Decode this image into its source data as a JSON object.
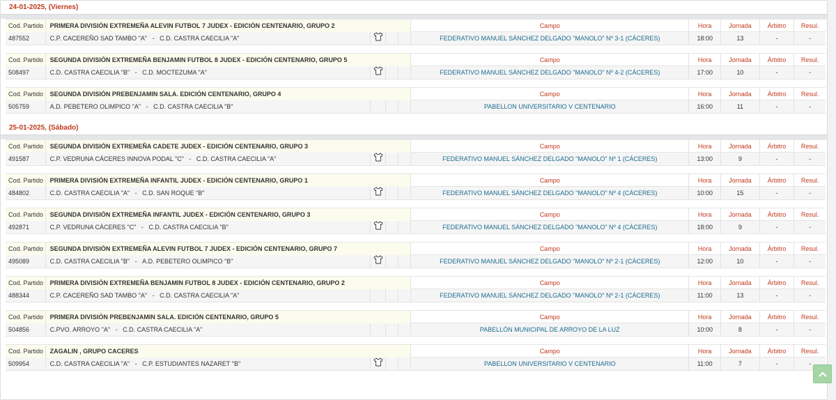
{
  "labels": {
    "code": "Cod. Partido",
    "campo": "Campo",
    "hora": "Hora",
    "jornada": "Jornada",
    "arbitro": "Árbitro",
    "resul": "Resul."
  },
  "days": [
    {
      "date": "24-01-2025,  (Viernes)",
      "matches": [
        {
          "competition": "PRIMERA DIVISIÓN EXTREMEÑA ALEVIN FUTBOL 7 JUDEX - EDICIÓN CENTENARIO, GRUPO 2",
          "code": "487552",
          "home": "C.P. CACEREÑO SAD TAMBO \"A\"",
          "away": "C.D. CASTRA CAECILIA \"A\"",
          "shirt": true,
          "campo": "FEDERATIVO MANUEL SÁNCHEZ DELGADO \"MANOLO\" Nº 3-1 (CÁCERES)",
          "hora": "18:00",
          "jornada": "13",
          "arbitro": "-",
          "resul": "-"
        },
        {
          "competition": "SEGUNDA DIVISIÓN EXTREMEÑA BENJAMIN FUTBOL 8 JUDEX - EDICIÓN CENTENARIO, GRUPO 5",
          "code": "508497",
          "home": "C.D. CASTRA CAECILIA \"B\"",
          "away": "C.D. MOCTEZUMA \"A\"",
          "shirt": true,
          "campo": "FEDERATIVO MANUEL SÁNCHEZ DELGADO \"MANOLO\" Nº 4-2 (CÁCERES)",
          "hora": "17:00",
          "jornada": "10",
          "arbitro": "-",
          "resul": "-"
        },
        {
          "competition": "SEGUNDA DIVISIÓN PREBENJAMIN SALA. EDICIÓN CENTENARIO, GRUPO 4",
          "code": "505759",
          "home": "A.D. PEBETERO OLIMPICO \"A\"",
          "away": "C.D. CASTRA CAECILIA \"B\"",
          "shirt": false,
          "campo": "PABELLON UNIVERSITARIO V CENTENARIO",
          "hora": "16:00",
          "jornada": "11",
          "arbitro": "-",
          "resul": "-"
        }
      ]
    },
    {
      "date": "25-01-2025,  (Sábado)",
      "matches": [
        {
          "competition": "SEGUNDA DIVISIÓN EXTREMEÑA CADETE JUDEX - EDICIÓN CENTENARIO, GRUPO 3",
          "code": "491587",
          "home": "C.P. VEDRUNA CÁCERES INNOVA PODAL \"C\"",
          "away": "C.D. CASTRA CAECILIA \"A\"",
          "shirt": true,
          "campo": "FEDERATIVO MANUEL SÁNCHEZ DELGADO \"MANOLO\" Nº 1 (CÁCERES)",
          "hora": "13:00",
          "jornada": "9",
          "arbitro": "-",
          "resul": "-"
        },
        {
          "competition": "PRIMERA DIVISIÓN EXTREMEÑA INFANTIL JUDEX - EDICIÓN CENTENARIO, GRUPO 1",
          "code": "484802",
          "home": "C.D. CASTRA CAECILIA \"A\"",
          "away": "C.D. SAN ROQUE \"B\"",
          "shirt": true,
          "campo": "FEDERATIVO MANUEL SÁNCHEZ DELGADO \"MANOLO\" Nº 4 (CÁCERES)",
          "hora": "10:00",
          "jornada": "15",
          "arbitro": "-",
          "resul": "-"
        },
        {
          "competition": "SEGUNDA DIVISIÓN EXTREMEÑA INFANTIL JUDEX - EDICIÓN CENTENARIO, GRUPO 3",
          "code": "492871",
          "home": "C.P. VEDRUNA CÁCERES \"C\"",
          "away": "C.D. CASTRA CAECILIA \"B\"",
          "shirt": true,
          "campo": "FEDERATIVO MANUEL SÁNCHEZ DELGADO \"MANOLO\" Nº 4 (CÁCERES)",
          "hora": "18:00",
          "jornada": "9",
          "arbitro": "-",
          "resul": "-"
        },
        {
          "competition": "SEGUNDA DIVISIÓN EXTREMEÑA ALEVIN FUTBOL 7 JUDEX - EDICIÓN CENTENARIO, GRUPO 7",
          "code": "495089",
          "home": "C.D. CASTRA CAECILIA \"B\"",
          "away": "A.D. PEBETERO OLIMPICO \"B\"",
          "shirt": true,
          "campo": "FEDERATIVO MANUEL SÁNCHEZ DELGADO \"MANOLO\" Nº 2-1 (CÁCERES)",
          "hora": "12:00",
          "jornada": "10",
          "arbitro": "-",
          "resul": "-"
        },
        {
          "competition": "PRIMERA DIVISIÓN EXTREMEÑA BENJAMIN FUTBOL 8 JUDEX - EDICIÓN CENTENARIO, GRUPO 2",
          "code": "488344",
          "home": "C.P. CACEREÑO SAD TAMBO \"A\"",
          "away": "C.D. CASTRA CAECILIA \"A\"",
          "shirt": false,
          "campo": "FEDERATIVO MANUEL SÁNCHEZ DELGADO \"MANOLO\" Nº 2-1 (CÁCERES)",
          "hora": "11:00",
          "jornada": "13",
          "arbitro": "-",
          "resul": "-"
        },
        {
          "competition": "PRIMERA DIVISIÓN PREBENJAMIN SALA. EDICIÓN CENTENARIO, GRUPO 5",
          "code": "504856",
          "home": "C.PVO. ARROYO \"A\"",
          "away": "C.D. CASTRA CAECILIA \"A\"",
          "shirt": false,
          "campo": "PABELLÓN MUNICIPAL DE ARROYO DE LA LUZ",
          "hora": "10:00",
          "jornada": "8",
          "arbitro": "-",
          "resul": "-"
        },
        {
          "competition": "ZAGALIN , GRUPO CACERES",
          "code": "509954",
          "home": "C.D. CASTRA CAECILIA \"A\"",
          "away": "C.P. ESTUDIANTES NAZARET \"B\"",
          "shirt": true,
          "campo": "PABELLON UNIVERSITARIO V CENTENARIO",
          "hora": "11:00",
          "jornada": "7",
          "arbitro": "-",
          "resul": "-"
        }
      ]
    }
  ],
  "icons": {
    "shirt": "shirt-icon",
    "scroll_top": "chevron-up-icon"
  },
  "colors": {
    "accent": "#c0391b",
    "link": "#1a6b8f",
    "header_bg": "#fcfcee",
    "scroll_btn": "#a6d6a6"
  }
}
